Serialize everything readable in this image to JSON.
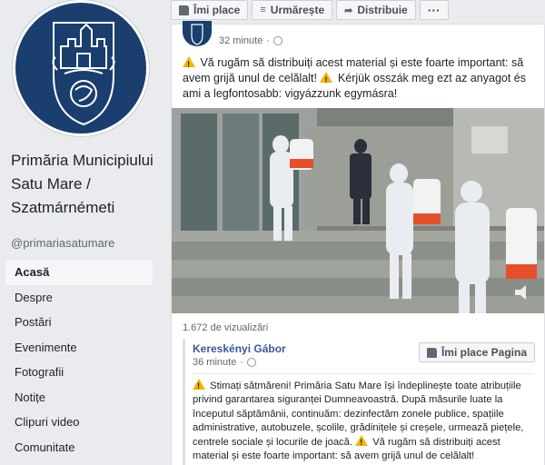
{
  "page": {
    "name": "Primăria Municipiului Satu Mare / Szatmárnémeti",
    "handle": "@primariasatumare"
  },
  "nav": [
    {
      "label": "Acasă",
      "active": true
    },
    {
      "label": "Despre"
    },
    {
      "label": "Postări"
    },
    {
      "label": "Evenimente"
    },
    {
      "label": "Fotografii"
    },
    {
      "label": "Notițe"
    },
    {
      "label": "Clipuri video"
    },
    {
      "label": "Comunitate"
    }
  ],
  "actions": {
    "like": "Îmi place",
    "follow": "Urmărește",
    "share": "Distribuie",
    "more": "···"
  },
  "post": {
    "time": "32 minute",
    "text_1": " Vă rugăm să distribuiți acest material și este foarte important: să avem grijă unul de celălalt! ",
    "text_2": " Kérjük osszák meg ezt az anyagot és ami a legfontosabb: vigyázzunk egymásra!",
    "views": "1.672 de vizualizări"
  },
  "shared": {
    "author": "Kereskényi Gábor",
    "time": "36 minute",
    "like_page": "Îmi place Pagina",
    "text_1": " Stimați sătmăreni! Primăria Satu Mare își îndeplinește toate atribuțiile privind garantarea siguranței Dumneavoastră. După măsurile luate la începutul săptămânii, continuăm: dezinfectăm zonele publice, spațiile administrative, autobuzele, școlile, grădinițele și creșele, urmează piețele, centrele sociale și locurile de joacă. ",
    "text_2": " Vă rugăm să distribuiți acest material și este foarte important: să avem grijă unul de celălalt!"
  },
  "colors": {
    "brand_blue": "#1a3e6e",
    "link_blue": "#385898",
    "warning_yellow": "#f5b400"
  }
}
